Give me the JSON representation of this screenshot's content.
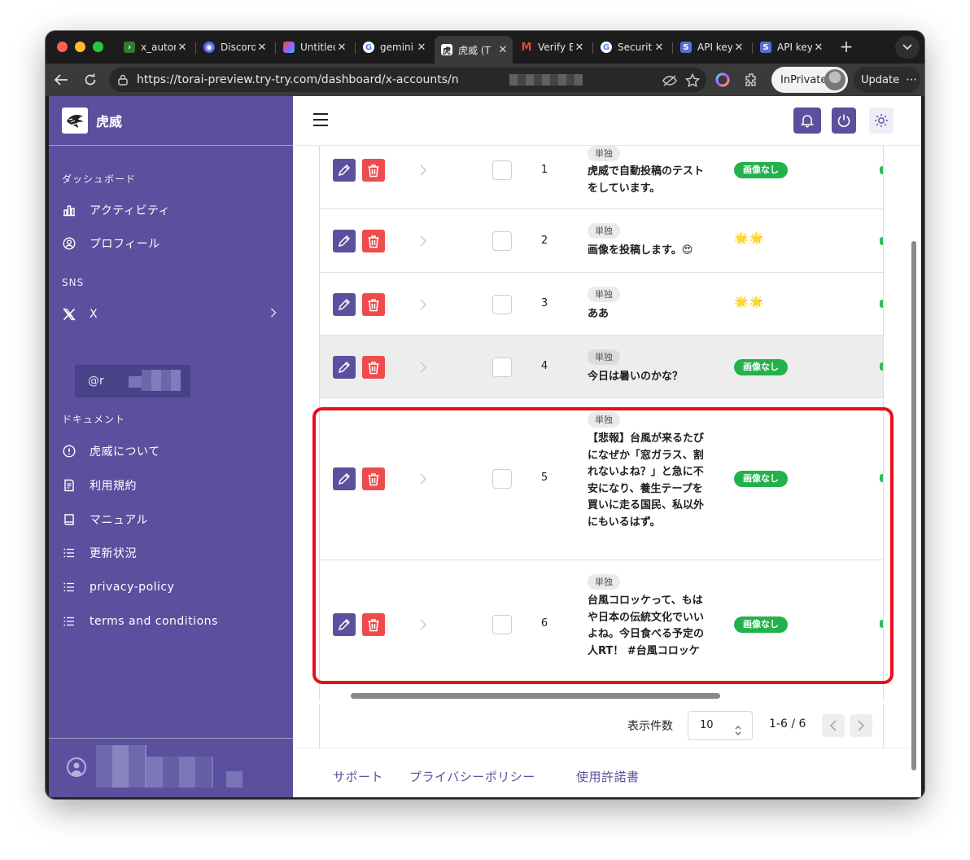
{
  "browser": {
    "tabs": [
      {
        "label": "x_autor",
        "icon": "terminal-icon",
        "color": "#2e7d32"
      },
      {
        "label": "Discord",
        "icon": "discord-icon",
        "color": "#5865f2"
      },
      {
        "label": "Untitled",
        "icon": "figma-icon",
        "color": "#a259ff"
      },
      {
        "label": "gemini",
        "icon": "google-icon",
        "color": "#4285f4"
      },
      {
        "label": "虎威 (T",
        "icon": "torai-icon",
        "color": "#ffffff",
        "active": true
      },
      {
        "label": "Verify E",
        "icon": "gmail-icon",
        "color": "#ea4335"
      },
      {
        "label": "Securit",
        "icon": "google-icon",
        "color": "#4285f4"
      },
      {
        "label": "API key",
        "icon": "api-icon",
        "color": "#5b6bd6"
      },
      {
        "label": "API key",
        "icon": "api-icon",
        "color": "#5b6bd6"
      }
    ],
    "url": "https://torai-preview.try-try.com/dashboard/x-accounts/n",
    "inprivate_label": "InPrivate",
    "update_label": "Update"
  },
  "sidebar": {
    "brand": "虎威",
    "sections": {
      "dashboard": "ダッシュボード",
      "sns": "SNS",
      "docs": "ドキュメント"
    },
    "dashboard_items": [
      {
        "label": "アクティビティ",
        "icon": "bar-chart-icon"
      },
      {
        "label": "プロフィール",
        "icon": "user-circle-icon"
      }
    ],
    "sns_items": [
      {
        "label": "X",
        "icon": "x-logo-icon"
      }
    ],
    "account_handle": "@r",
    "doc_items": [
      {
        "label": "虎威について",
        "icon": "info-icon"
      },
      {
        "label": "利用規約",
        "icon": "document-icon"
      },
      {
        "label": "マニュアル",
        "icon": "book-icon"
      },
      {
        "label": "更新状況",
        "icon": "list-icon"
      },
      {
        "label": "privacy-policy",
        "icon": "list-icon"
      },
      {
        "label": "terms and conditions",
        "icon": "list-icon"
      }
    ]
  },
  "table": {
    "rows": [
      {
        "num": "1",
        "tag": "単独",
        "text": "虎威で自動投稿のテストをしています。",
        "media": "badge",
        "badge": "画像なし"
      },
      {
        "num": "2",
        "tag": "単独",
        "text": "画像を投稿します。😍",
        "media": "stars",
        "stars": "🌟🌟"
      },
      {
        "num": "3",
        "tag": "単独",
        "text": "ああ",
        "media": "stars",
        "stars": "🌟🌟"
      },
      {
        "num": "4",
        "tag": "単独",
        "text": "今日は暑いのかな？",
        "media": "badge",
        "badge": "画像なし"
      },
      {
        "num": "5",
        "tag": "単独",
        "text": "【悲報】台風が来るたびになぜか「窓ガラス、割れないよね？」と急に不安になり、養生テープを買いに走る国民、私以外にもいるはず。",
        "media": "badge",
        "badge": "画像なし"
      },
      {
        "num": "6",
        "tag": "単独",
        "text": "台風コロッケって、もはや日本の伝統文化でいいよね。今日食べる予定の人RT！ #台風コロッケ",
        "media": "badge",
        "badge": "画像なし"
      }
    ]
  },
  "pager": {
    "per_page_label": "表示件数",
    "per_page_value": "10",
    "range": "1-6 / 6"
  },
  "footer": {
    "support": "サポート",
    "privacy": "プライバシーポリシー",
    "license": "使用許諾書"
  },
  "colors": {
    "brand_purple": "#5a509e",
    "delete_red": "#ee4c4c",
    "badge_green": "#22b24c",
    "highlight_red": "#e8101c"
  }
}
